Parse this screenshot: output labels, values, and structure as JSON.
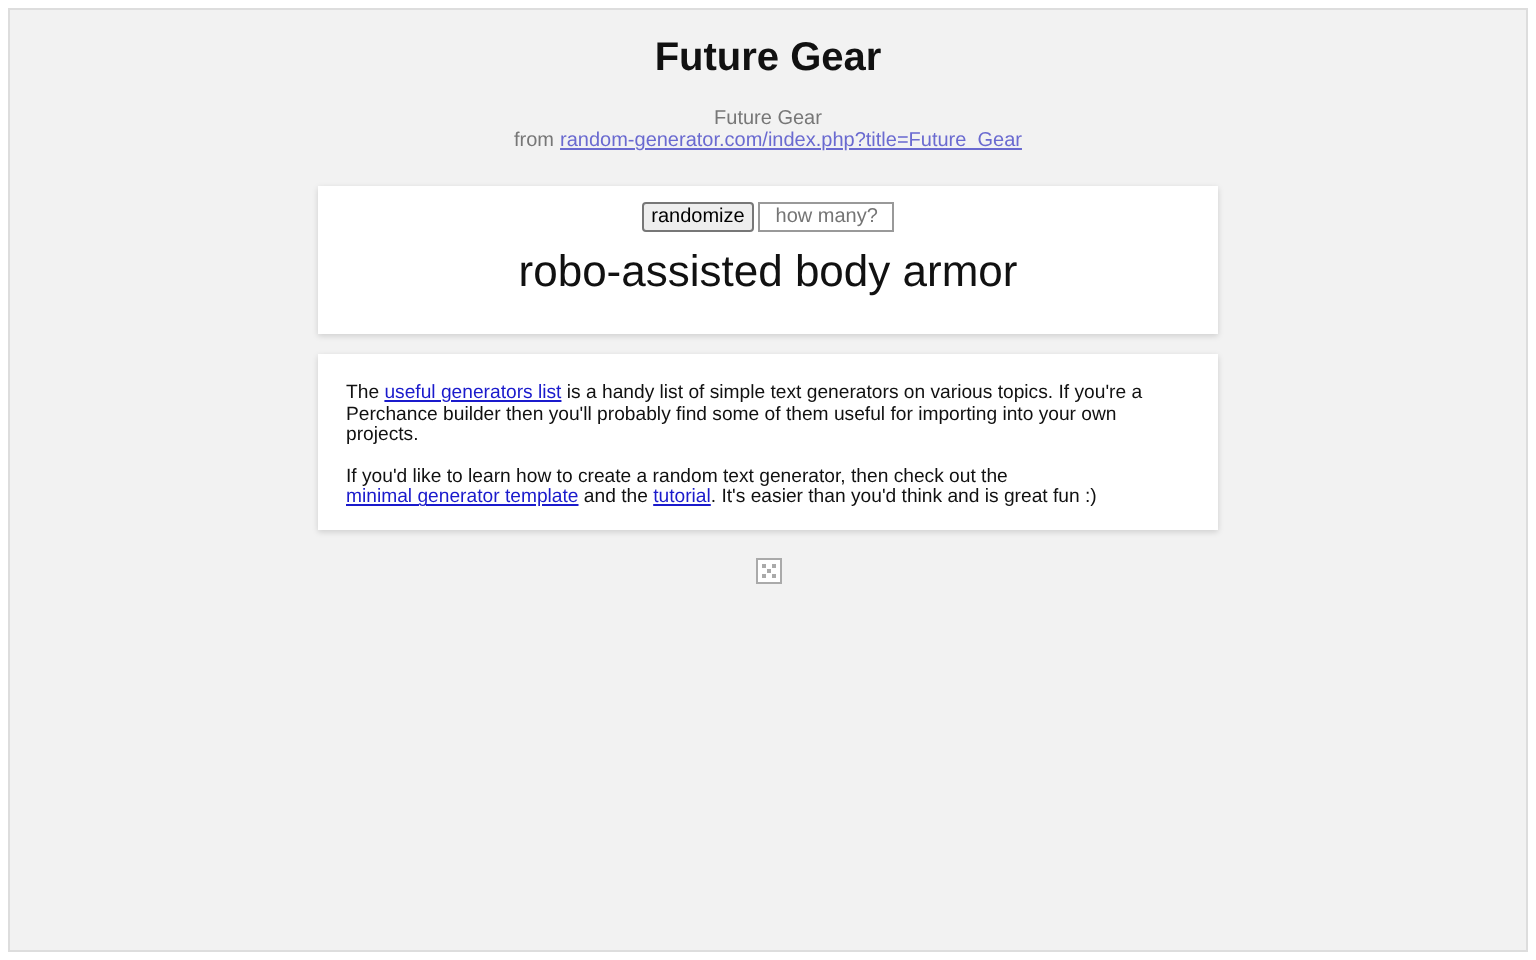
{
  "title": "Future Gear",
  "source": {
    "name": "Future Gear",
    "prefix": "from",
    "link": "random-generator.com/index.php?title=Future_Gear"
  },
  "generator": {
    "button": "randomize",
    "count_placeholder": "how many?",
    "result": "robo-assisted body armor"
  },
  "info": [
    [
      {
        "text": "The "
      },
      {
        "text": "useful generators list",
        "link": true
      },
      {
        "text": " is a handy list of simple text generators on various topics. If you're a Perchance builder then you'll probably find some of them useful for importing into your own projects."
      }
    ],
    [
      {
        "text": "If you'd like to learn how to create a random text generator, then check out the "
      },
      {
        "text": "minimal generator template",
        "link": true
      },
      {
        "text": " and the "
      },
      {
        "text": "tutorial",
        "link": true
      },
      {
        "text": ". It's easier than you'd think and is great fun :)"
      }
    ]
  ]
}
